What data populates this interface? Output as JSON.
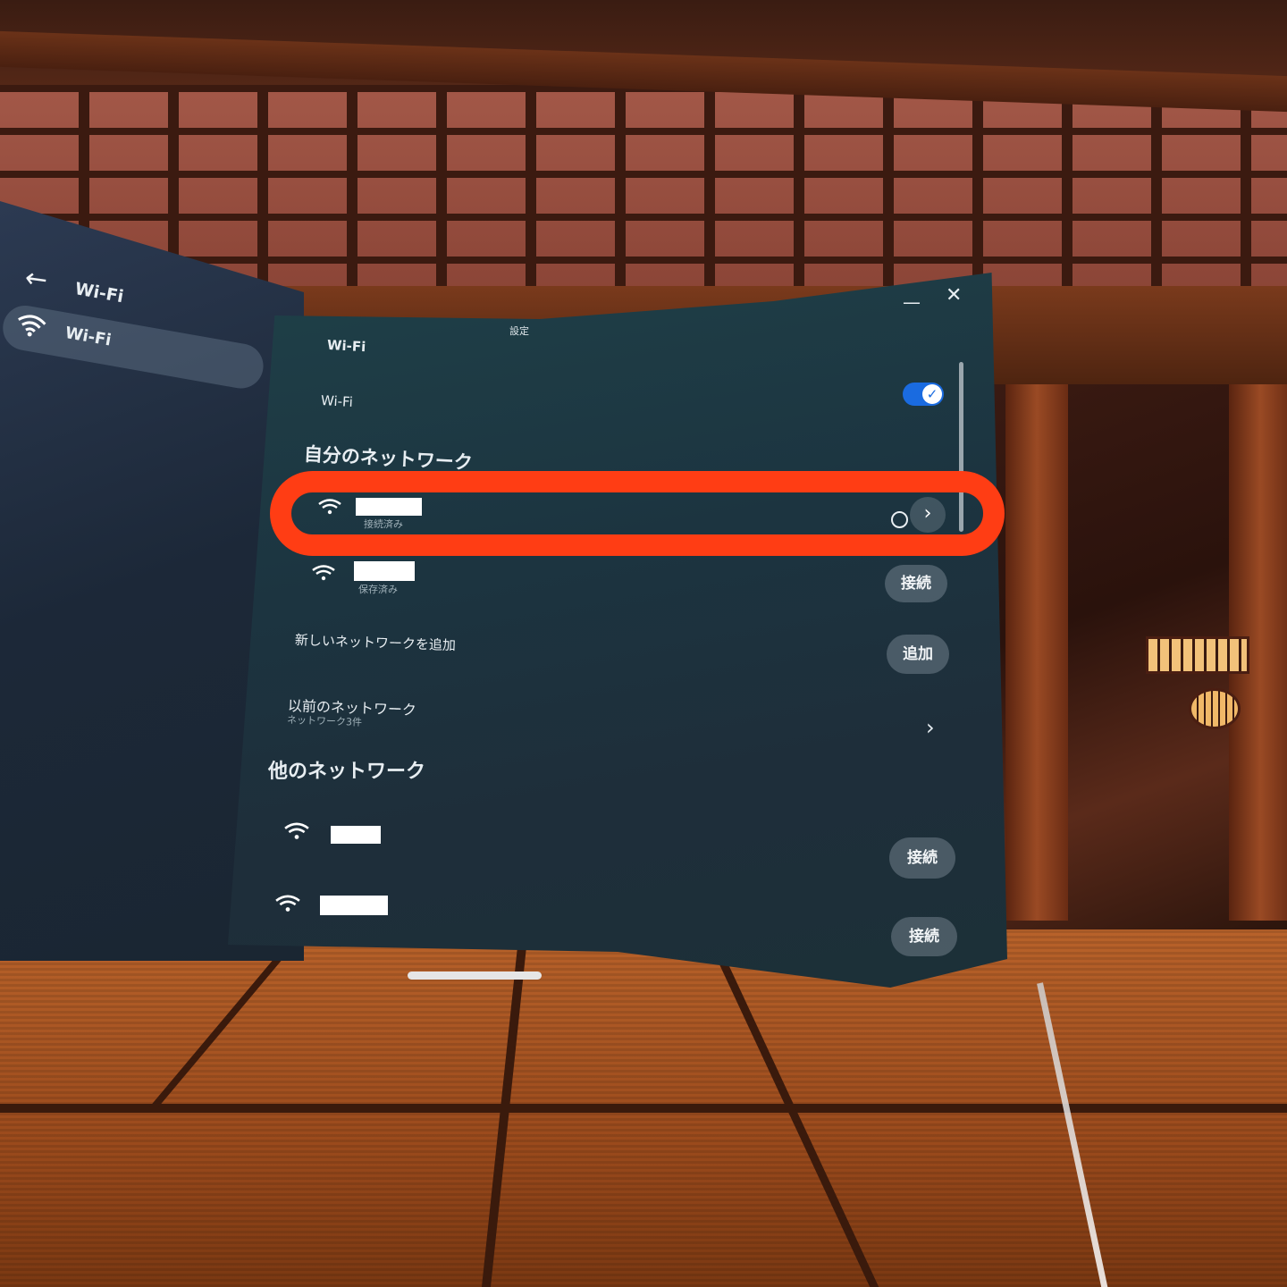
{
  "window": {
    "title": "設定"
  },
  "sidebar": {
    "title": "Wi-Fi",
    "items": [
      {
        "label": "Wi-Fi"
      }
    ]
  },
  "main": {
    "section_title": "Wi-Fi",
    "wifi_toggle": {
      "label": "Wi-Fi",
      "state": "on"
    },
    "my_networks": {
      "heading": "自分のネットワーク",
      "items": [
        {
          "status": "接続済み"
        },
        {
          "status": "保存済み",
          "action": "接続"
        }
      ]
    },
    "add_network": {
      "label": "新しいネットワークを追加",
      "action": "追加"
    },
    "previous_networks": {
      "label": "以前のネットワーク",
      "sub": "ネットワーク3件"
    },
    "other_networks": {
      "heading": "他のネットワーク",
      "items": [
        {
          "action": "接続"
        },
        {
          "action": "接続"
        }
      ]
    }
  },
  "colors": {
    "accent": "#1a6be0",
    "highlight": "#ff3d14"
  },
  "icons": [
    "back-arrow-icon",
    "wifi-icon",
    "chevron-right-icon",
    "minimize-icon",
    "close-icon",
    "check-icon"
  ]
}
